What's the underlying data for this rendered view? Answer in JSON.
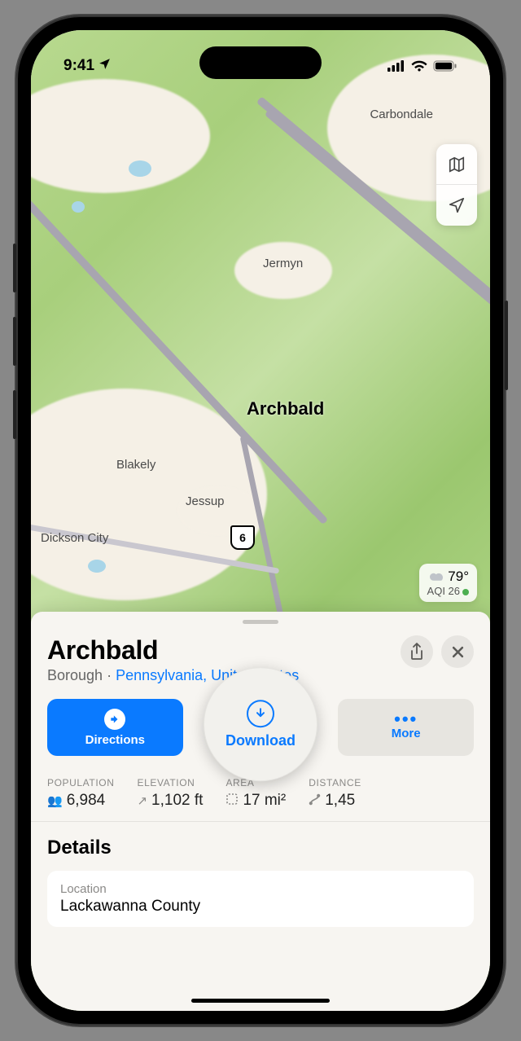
{
  "status": {
    "time": "9:41"
  },
  "map": {
    "labels": {
      "main": "Archbald",
      "carbondale": "Carbondale",
      "jermyn": "Jermyn",
      "blakely": "Blakely",
      "jessup": "Jessup",
      "dickson": "Dickson City"
    },
    "route_shield": "6"
  },
  "weather": {
    "temp": "79°",
    "aqi": "AQI 26"
  },
  "sheet": {
    "title": "Archbald",
    "subtype": "Borough",
    "region_link": "Pennsylvania, United States",
    "actions": {
      "directions": "Directions",
      "download": "Download",
      "more": "More"
    },
    "stats": {
      "population": {
        "label": "POPULATION",
        "value": "6,984"
      },
      "elevation": {
        "label": "ELEVATION",
        "value": "1,102 ft"
      },
      "area": {
        "label": "AREA",
        "value": "17 mi²"
      },
      "distance": {
        "label": "DISTANCE",
        "value": "1,45"
      }
    },
    "details": {
      "heading": "Details",
      "location_label": "Location",
      "location_value": "Lackawanna County"
    }
  }
}
